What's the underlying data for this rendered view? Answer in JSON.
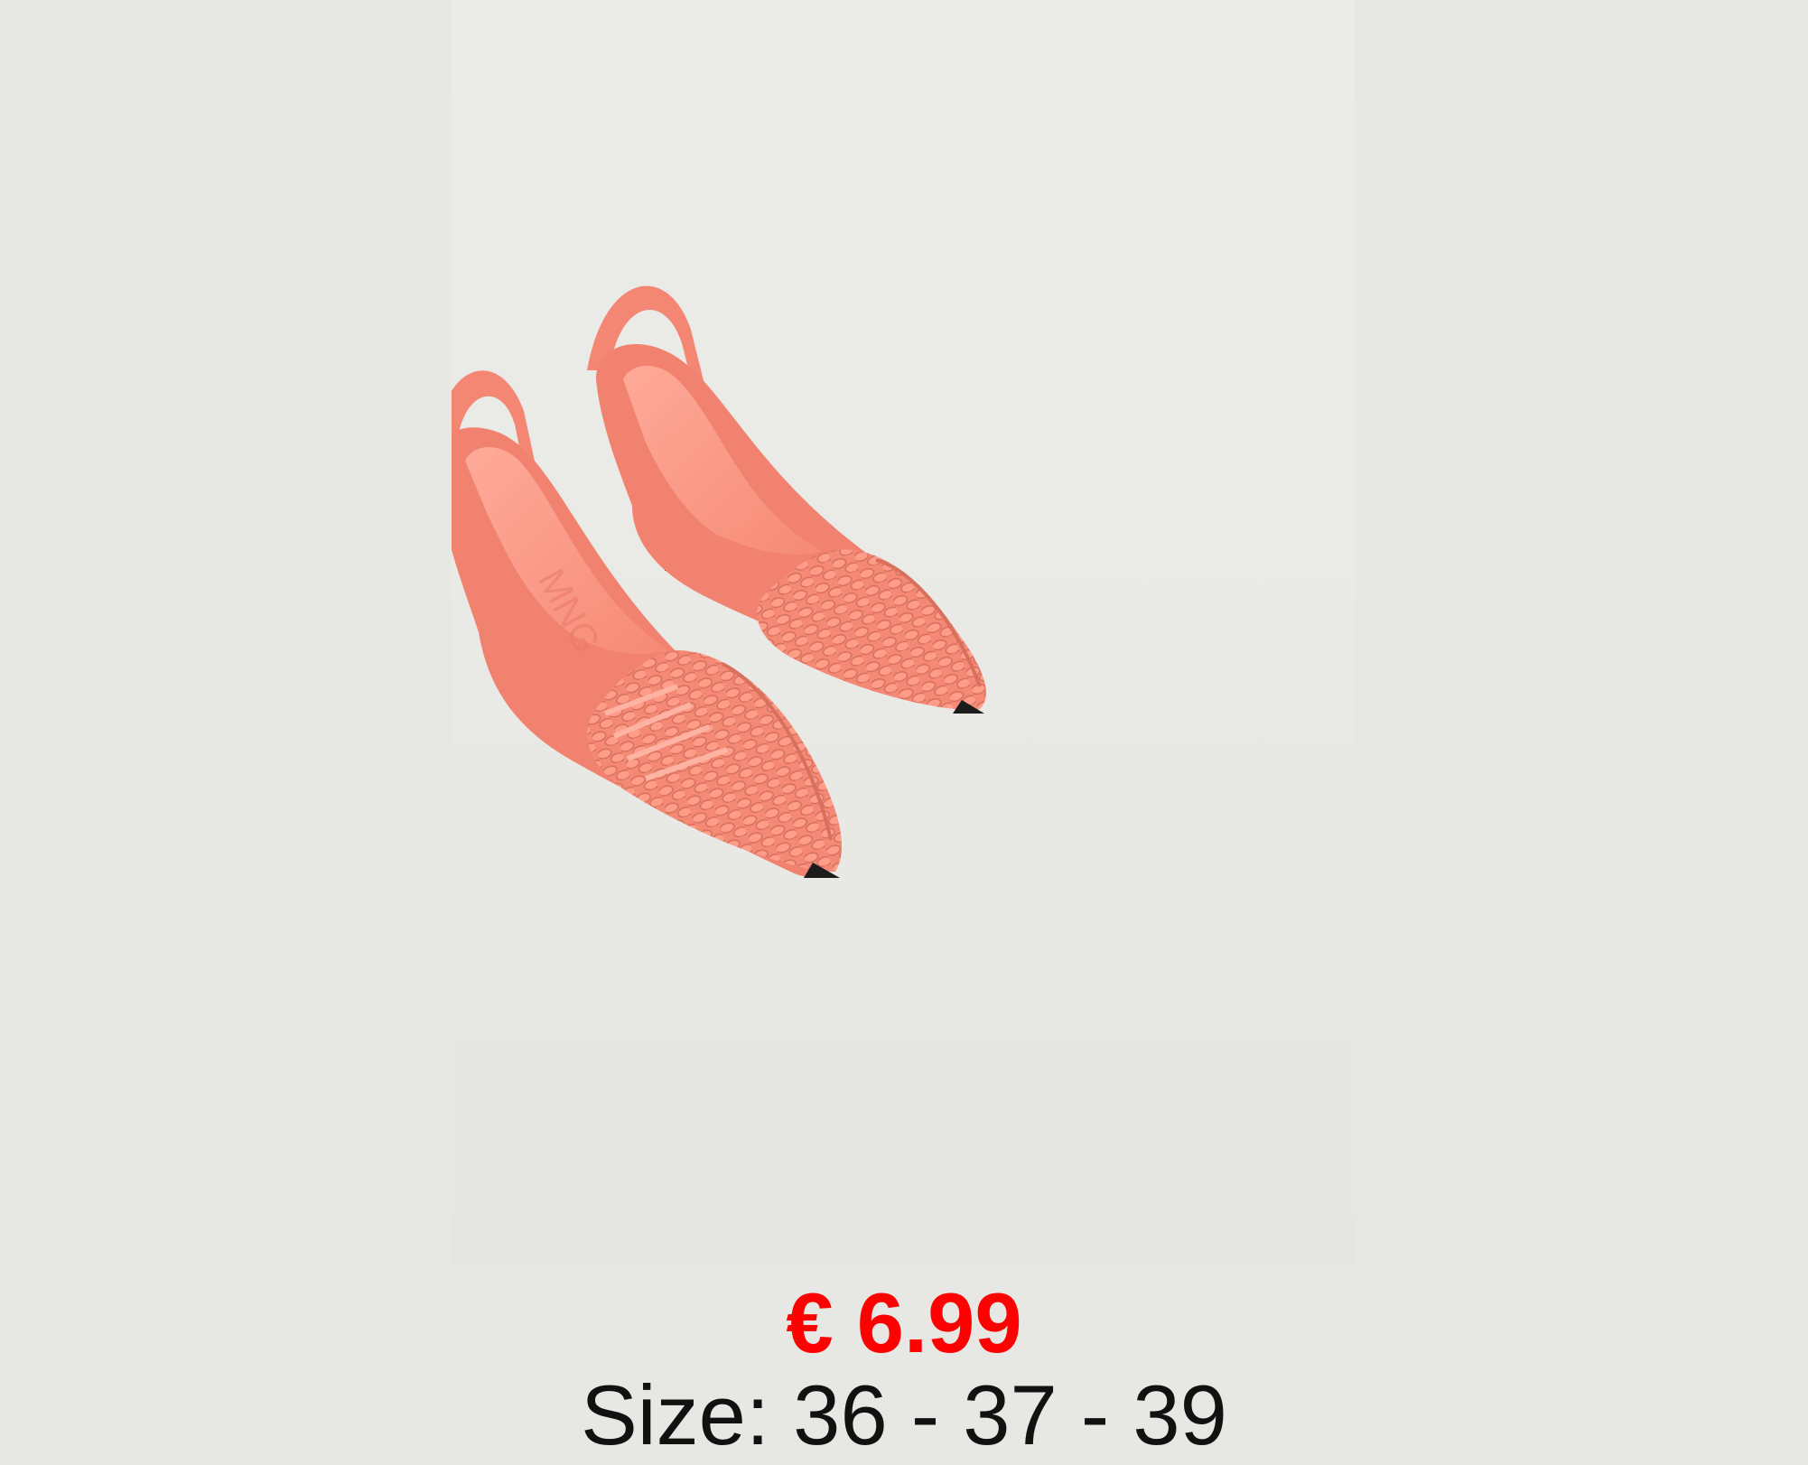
{
  "product": {
    "price": "€ 6.99",
    "size": "Size: 36 - 37 - 39",
    "image_description_icon": "coral-woven-slingback-pumps-photo"
  },
  "colors": {
    "background": "#e7e7e3",
    "shoe": "#f58a76",
    "price": "#ff0000",
    "text": "#111111"
  }
}
